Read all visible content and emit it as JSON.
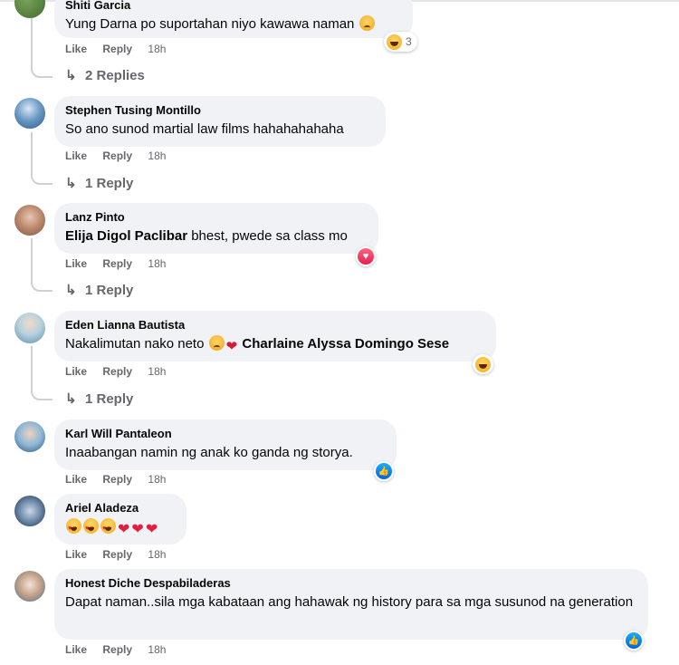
{
  "comments": [
    {
      "author": "Shiti Garcia",
      "text": "Yung Darna po suportahan niyo kawawa naman",
      "like": "Like",
      "reply": "Reply",
      "time": "18h",
      "reaction_count": "3",
      "replies_label": "2 Replies"
    },
    {
      "author": "Stephen Tusing Montillo",
      "text": "So ano sunod martial law films hahahahahaha",
      "like": "Like",
      "reply": "Reply",
      "time": "18h",
      "replies_label": "1 Reply"
    },
    {
      "author": "Lanz Pinto",
      "mention": "Elija Digol Paclibar",
      "text": " bhest, pwede sa class mo",
      "like": "Like",
      "reply": "Reply",
      "time": "18h",
      "replies_label": "1 Reply"
    },
    {
      "author": "Eden Lianna Bautista",
      "text": "Nakalimutan nako neto ",
      "mention": "Charlaine Alyssa Domingo Sese",
      "like": "Like",
      "reply": "Reply",
      "time": "18h",
      "replies_label": "1 Reply"
    },
    {
      "author": "Karl Will Pantaleon",
      "text": "Inaabangan namin ng anak ko ganda ng storya.",
      "like": "Like",
      "reply": "Reply",
      "time": "18h"
    },
    {
      "author": "Ariel Aladeza",
      "text": "",
      "like": "Like",
      "reply": "Reply",
      "time": "18h"
    },
    {
      "author": "Honest Diche Despabiladeras",
      "text": "Dapat naman..sila mga kabataan ang hahawak ng history para sa mga susunod na generation",
      "like": "Like",
      "reply": "Reply",
      "time": "18h"
    }
  ],
  "icons": {
    "reply_arrow": "reply-arrow-icon",
    "laugh": "laughing-emoji-icon",
    "love": "love-reaction-icon",
    "like": "like-reaction-icon"
  },
  "colors": {
    "bubble": "#f0f2f5",
    "meta": "#65676b",
    "love": "#e41e3f",
    "like": "#0866ff"
  }
}
